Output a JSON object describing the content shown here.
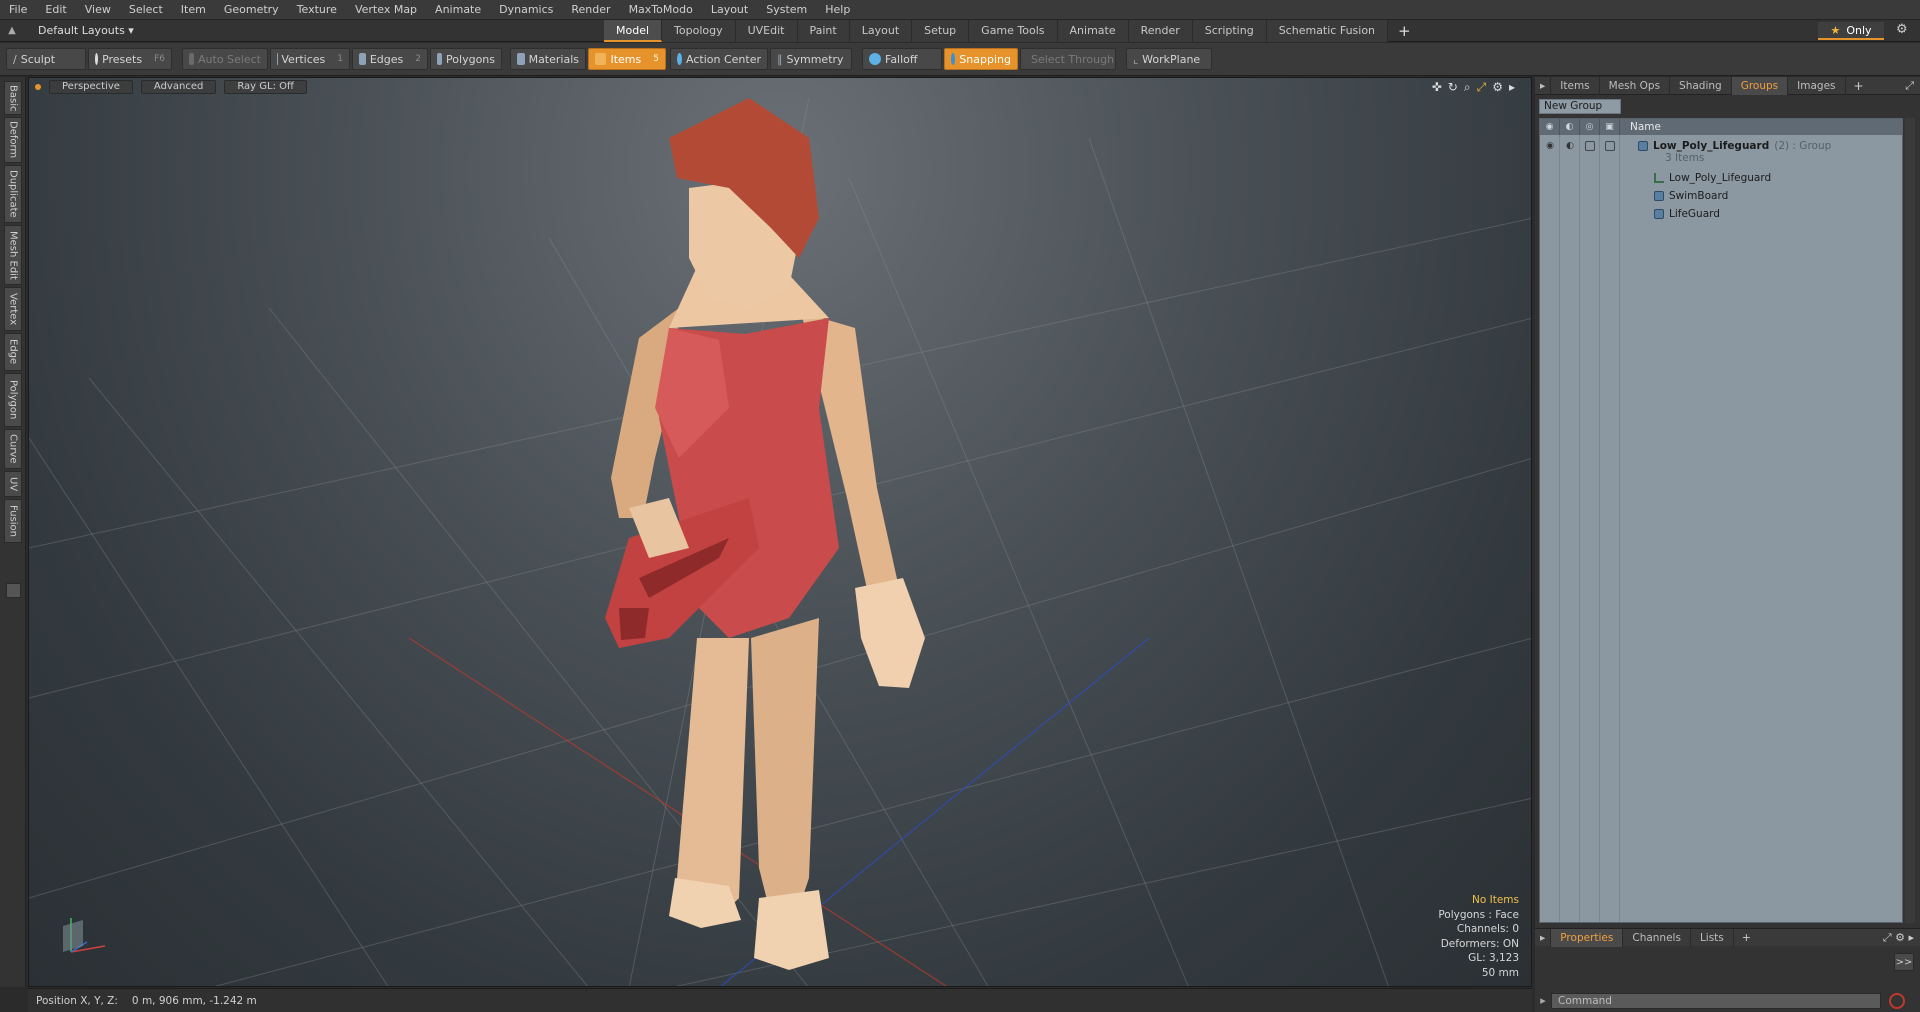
{
  "menu": [
    "File",
    "Edit",
    "View",
    "Select",
    "Item",
    "Geometry",
    "Texture",
    "Vertex Map",
    "Animate",
    "Dynamics",
    "Render",
    "MaxToModo",
    "Layout",
    "System",
    "Help"
  ],
  "layout_label": "Default Layouts ▾",
  "tabs": [
    "Model",
    "Topology",
    "UVEdit",
    "Paint",
    "Layout",
    "Setup",
    "Game Tools",
    "Animate",
    "Render",
    "Scripting",
    "Schematic Fusion"
  ],
  "active_tab": "Model",
  "only_label": "Only",
  "toolbar": {
    "sculpt": "Sculpt",
    "presets": "Presets",
    "presets_key": "F6",
    "auto_select": "Auto Select",
    "vertices": "Vertices",
    "vertices_key": "1",
    "edges": "Edges",
    "edges_key": "2",
    "polygons": "Polygons",
    "materials": "Materials",
    "items": "Items",
    "items_key": "5",
    "action_center": "Action Center",
    "symmetry": "Symmetry",
    "falloff": "Falloff",
    "snapping": "Snapping",
    "select_through": "Select Through",
    "workplane": "WorkPlane"
  },
  "left_tabs": [
    "Basic",
    "Deform",
    "Duplicate",
    "Mesh Edit",
    "Vertex",
    "Edge",
    "Polygon",
    "Curve",
    "UV",
    "Fusion"
  ],
  "viewport": {
    "view": "Perspective",
    "shading": "Advanced",
    "raygl": "Ray GL: Off",
    "info": {
      "selection": "No Items",
      "polygons": "Polygons : Face",
      "channels": "Channels: 0",
      "deformers": "Deformers: ON",
      "gl": "GL: 3,123",
      "lens": "50 mm"
    }
  },
  "status": {
    "position_label": "Position X, Y, Z:",
    "position_value": "0 m, 906 mm, -1.242 m"
  },
  "right_panel": {
    "tabs": [
      "Items",
      "Mesh Ops",
      "Shading",
      "Groups",
      "Images"
    ],
    "active_tab": "Groups",
    "new_group": "New Group",
    "name_header": "Name",
    "group": {
      "name": "Low_Poly_Lifeguard",
      "suffix": "(2) : Group",
      "count": "3 Items",
      "children": [
        "Low_Poly_Lifeguard",
        "SwimBoard",
        "LifeGuard"
      ]
    },
    "bottom_tabs": [
      "Properties",
      "Channels",
      "Lists"
    ],
    "bottom_active": "Properties",
    "more": ">>",
    "command_placeholder": "Command"
  },
  "colors": {
    "accent": "#e7932b",
    "swimsuit": "#c94b4b",
    "skin": "#e8c4a0",
    "hair": "#b34a35"
  }
}
